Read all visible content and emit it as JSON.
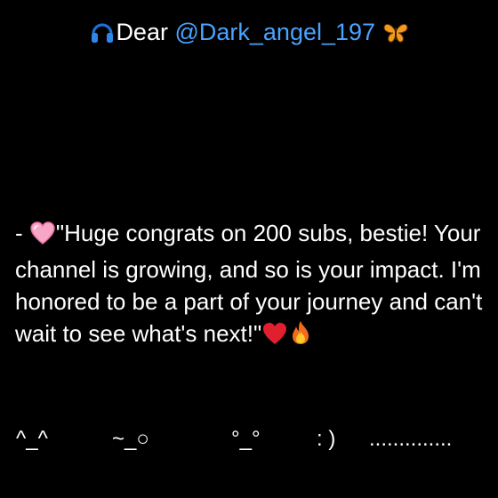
{
  "header": {
    "greeting": "Dear",
    "mention": "@Dark_angel_197",
    "leading_icon": "headphones-icon",
    "trailing_icon": "butterfly-icon"
  },
  "message": {
    "prefix": "- ",
    "text": "\"Huge congrats on 200 subs, bestie! Your channel is growing, and so is your impact. I'm honored to be a part of your journey and can't wait to see what's next!\"",
    "leading_emoji": "pink-heart-icon",
    "trailing_emojis": [
      "red-heart-icon",
      "fire-icon"
    ]
  },
  "faces": [
    "^_^",
    "~_○",
    "°_°",
    ": )",
    ".............."
  ],
  "colors": {
    "background": "#000000",
    "text": "#ffffff",
    "mention": "#4aa3ff"
  }
}
